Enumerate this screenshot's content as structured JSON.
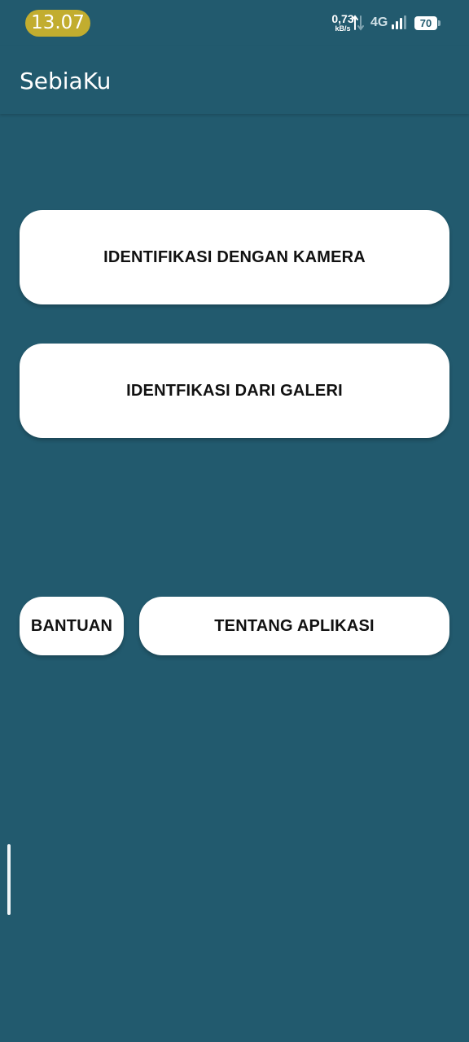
{
  "status_bar": {
    "time": "13.07",
    "net_speed_value": "0,73",
    "net_speed_unit": "kB/s",
    "network_type": "4G",
    "battery_level": "70",
    "icons": [
      "data-arrows-icon",
      "signal-bars-icon",
      "battery-icon"
    ]
  },
  "app_bar": {
    "title": "SebiaKu"
  },
  "main": {
    "camera_button_label": "IDENTIFIKASI DENGAN KAMERA",
    "gallery_button_label": "IDENTFIKASI DARI GALERI",
    "help_button_label": "BANTUAN",
    "about_button_label": "TENTANG APLIKASI"
  },
  "colors": {
    "background": "#225a6e",
    "time_pill": "#c2ad2f",
    "button_background": "#ffffff",
    "button_text": "#111111"
  }
}
